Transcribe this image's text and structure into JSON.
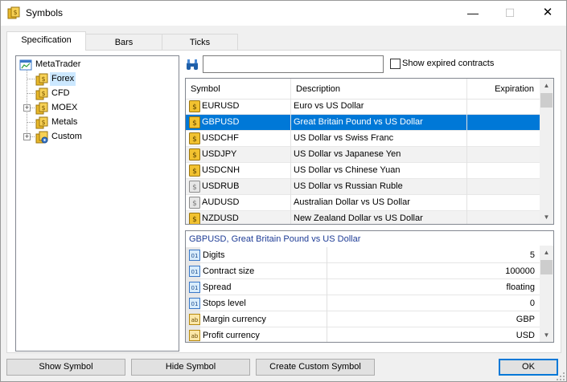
{
  "window": {
    "title": "Symbols",
    "minimize": "—",
    "maximize": "☐",
    "close": "✕"
  },
  "tabs": [
    {
      "label": "Specification"
    },
    {
      "label": "Bars"
    },
    {
      "label": "Ticks"
    }
  ],
  "tree": {
    "root": "MetaTrader",
    "items": [
      {
        "label": "Forex",
        "expandable": false,
        "selected": true
      },
      {
        "label": "CFD",
        "expandable": false
      },
      {
        "label": "MOEX",
        "expandable": true
      },
      {
        "label": "Metals",
        "expandable": false
      },
      {
        "label": "Custom",
        "expandable": true
      }
    ],
    "expander_glyph": "+"
  },
  "search": {
    "value": "",
    "placeholder": ""
  },
  "show_expired": {
    "label": "Show expired contracts",
    "checked": false
  },
  "symbols": {
    "columns": [
      "Symbol",
      "Description",
      "Expiration"
    ],
    "rows": [
      {
        "symbol": "EURUSD",
        "description": "Euro vs US Dollar",
        "expiration": "",
        "active": true
      },
      {
        "symbol": "GBPUSD",
        "description": "Great Britain Pound vs US Dollar",
        "expiration": "",
        "active": true,
        "selected": true
      },
      {
        "symbol": "USDCHF",
        "description": "US Dollar vs Swiss Franc",
        "expiration": "",
        "active": true
      },
      {
        "symbol": "USDJPY",
        "description": "US Dollar vs Japanese Yen",
        "expiration": "",
        "active": true
      },
      {
        "symbol": "USDCNH",
        "description": "US Dollar vs Chinese Yuan",
        "expiration": "",
        "active": true
      },
      {
        "symbol": "USDRUB",
        "description": "US Dollar vs Russian Ruble",
        "expiration": "",
        "active": false
      },
      {
        "symbol": "AUDUSD",
        "description": "Australian Dollar vs US Dollar",
        "expiration": "",
        "active": false
      },
      {
        "symbol": "NZDUSD",
        "description": "New Zealand Dollar vs US Dollar",
        "expiration": "",
        "active": true
      }
    ]
  },
  "properties": {
    "title": "GBPUSD, Great Britain Pound vs US Dollar",
    "rows": [
      {
        "icon": "numeric-icon",
        "icon_text": "01",
        "name": "Digits",
        "value": "5"
      },
      {
        "icon": "numeric-icon",
        "icon_text": "01",
        "name": "Contract size",
        "value": "100000"
      },
      {
        "icon": "numeric-icon",
        "icon_text": "01",
        "name": "Spread",
        "value": "floating"
      },
      {
        "icon": "numeric-icon",
        "icon_text": "01",
        "name": "Stops level",
        "value": "0"
      },
      {
        "icon": "text-icon",
        "icon_text": "ab",
        "name": "Margin currency",
        "value": "GBP"
      },
      {
        "icon": "text-icon",
        "icon_text": "ab",
        "name": "Profit currency",
        "value": "USD"
      }
    ]
  },
  "buttons": {
    "show": "Show Symbol",
    "hide": "Hide Symbol",
    "custom": "Create Custom Symbol",
    "ok": "OK"
  },
  "scroll_glyphs": {
    "up": "▲",
    "down": "▼"
  },
  "colors": {
    "selection": "#0078d7",
    "tree_selection": "#cce8ff",
    "symbol_active": "#f2c230",
    "symbol_inactive": "#c8c8c8"
  }
}
